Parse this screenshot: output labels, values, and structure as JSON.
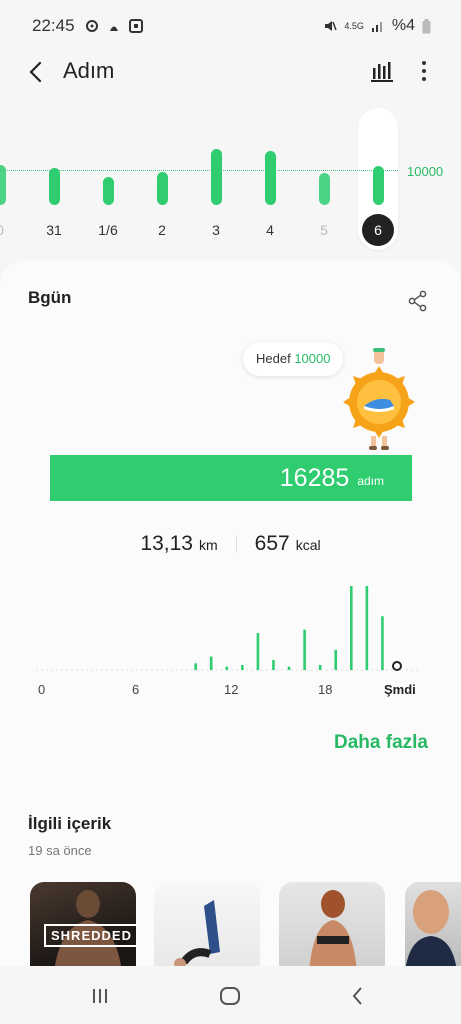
{
  "status_bar": {
    "time": "22:45",
    "battery_text": "%4",
    "network_text": "4.5G"
  },
  "header": {
    "title": "Adım"
  },
  "week_chart": {
    "goal_label": "10000",
    "days": [
      {
        "label": "0",
        "value": 11500,
        "dim": true
      },
      {
        "label": "31",
        "value": 10700,
        "dim": false
      },
      {
        "label": "1/6",
        "value": 8000,
        "dim": false
      },
      {
        "label": "2",
        "value": 9500,
        "dim": false
      },
      {
        "label": "3",
        "value": 16000,
        "dim": false
      },
      {
        "label": "4",
        "value": 15500,
        "dim": false
      },
      {
        "label": "5",
        "value": 9000,
        "dim": true
      },
      {
        "label": "6",
        "value": 11000,
        "selected": true
      }
    ]
  },
  "card": {
    "title": "Bgün",
    "goal_prefix": "Hedef",
    "goal_value": "10000",
    "steps": "16285",
    "steps_unit": "adım",
    "distance": "13,13",
    "distance_unit": "km",
    "calories": "657",
    "calories_unit": "kcal",
    "hour_labels": [
      "0",
      "6",
      "12",
      "18",
      "Şmdi"
    ],
    "more_label": "Daha fazla"
  },
  "chart_data": {
    "type": "bar",
    "title": "",
    "xlabel": "",
    "ylabel": "",
    "x": [
      0,
      1,
      2,
      3,
      4,
      5,
      6,
      7,
      8,
      9,
      10,
      11,
      12,
      13,
      14,
      15,
      16,
      17,
      18,
      19,
      20,
      21,
      22,
      23
    ],
    "values": [
      0,
      0,
      0,
      0,
      0,
      0,
      0,
      0,
      0,
      0,
      200,
      400,
      100,
      150,
      1100,
      300,
      100,
      1200,
      150,
      600,
      2500,
      2500,
      1600,
      100
    ],
    "categories_label": [
      "0",
      "6",
      "12",
      "18",
      "Şmdi"
    ]
  },
  "related": {
    "title": "İlgili içerik",
    "subtitle": "19 sa önce",
    "items": [
      {
        "badge": "SHREDDED"
      },
      {
        "badge": ""
      },
      {
        "badge": ""
      },
      {
        "badge": ""
      }
    ]
  },
  "colors": {
    "accent": "#2fcc70",
    "accent_text": "#27b964"
  }
}
